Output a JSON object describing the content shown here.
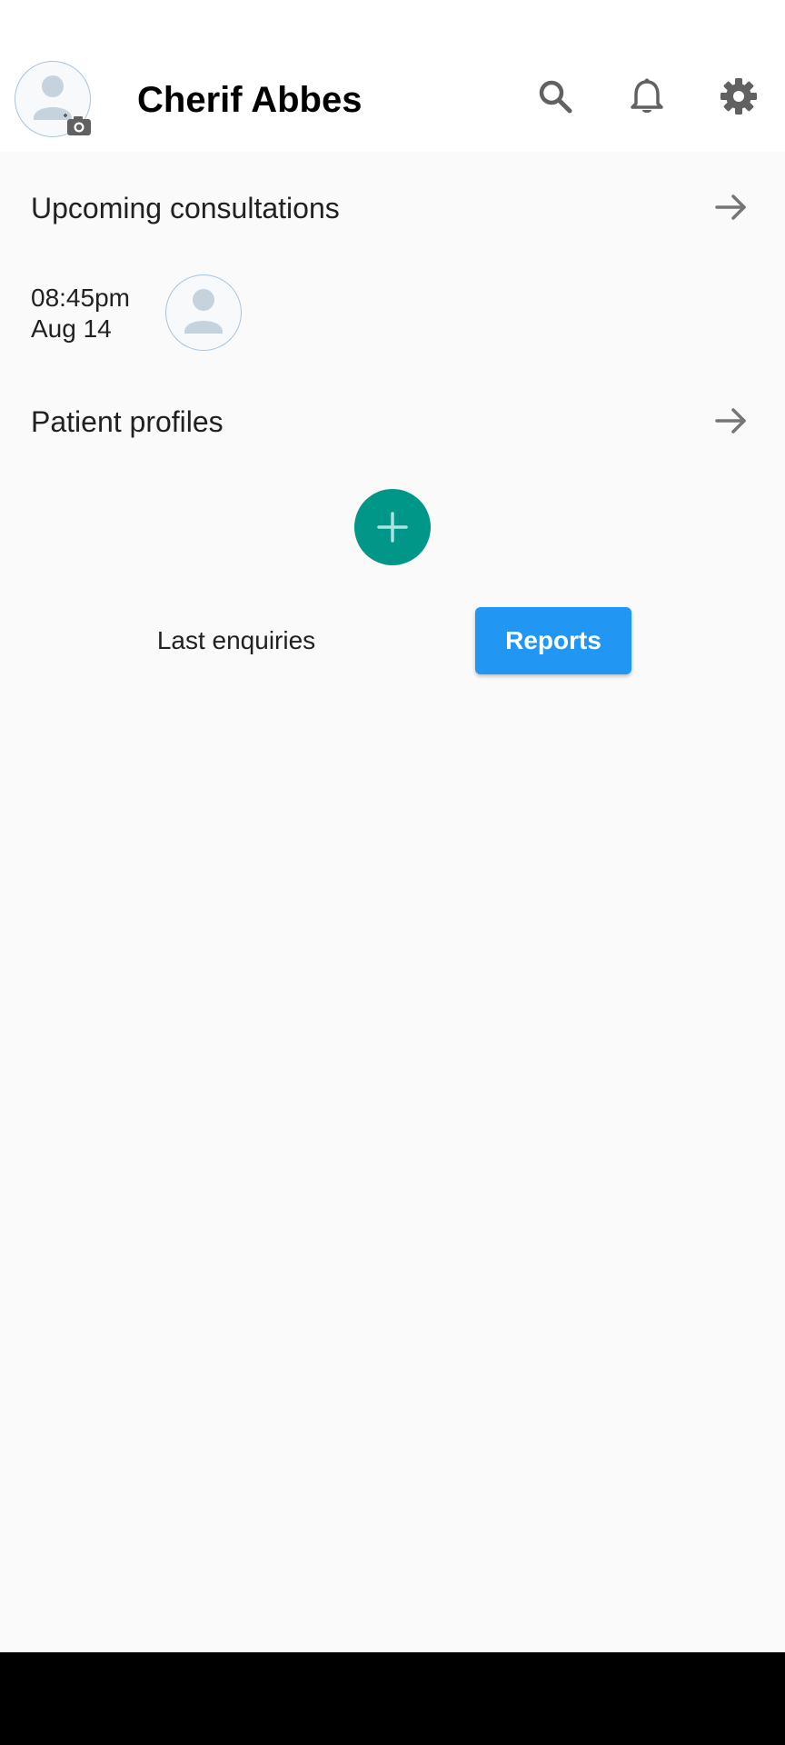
{
  "header": {
    "title": "Cherif Abbes",
    "icons": [
      "avatar",
      "camera-icon",
      "search-icon",
      "bell-icon",
      "gear-icon"
    ]
  },
  "upcoming": {
    "title": "Upcoming consultations",
    "items": [
      {
        "time": "08:45pm",
        "date": "Aug 14"
      }
    ]
  },
  "profiles": {
    "title": "Patient profiles"
  },
  "tabs": {
    "last_enquiries": "Last enquiries",
    "reports": "Reports"
  },
  "colors": {
    "accent_teal": "#009688",
    "accent_blue": "#2196f3",
    "icon_gray": "#616161"
  }
}
